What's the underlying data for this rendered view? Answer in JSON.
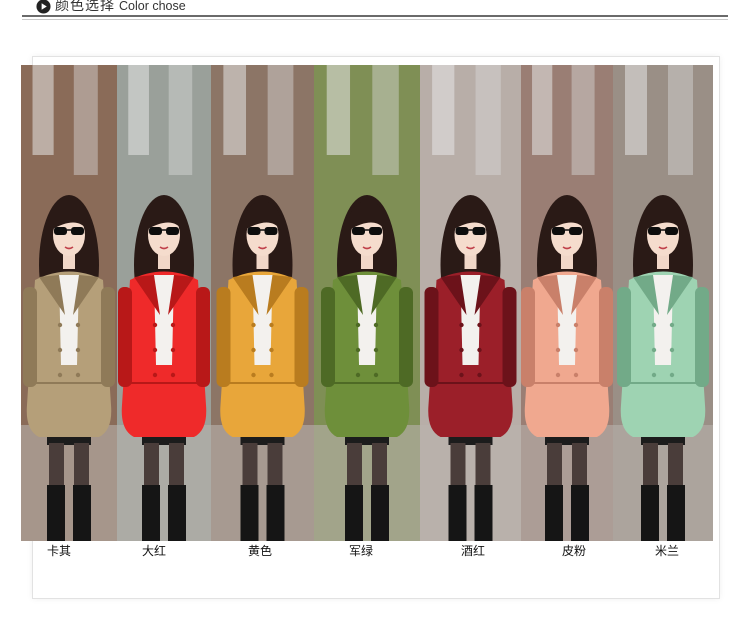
{
  "header": {
    "title_cn": "颜色选择",
    "title_en": "Color chose",
    "icon": "play-circle-icon"
  },
  "colors": [
    {
      "label": "卡其",
      "coat": "#b59f79",
      "coatDark": "#8f7a58",
      "bg": "#8a6b58"
    },
    {
      "label": "大红",
      "coat": "#ef2a2a",
      "coatDark": "#b81818",
      "bg": "#9aa09a"
    },
    {
      "label": "黄色",
      "coat": "#e8a63a",
      "coatDark": "#b97c1f",
      "bg": "#8c7566"
    },
    {
      "label": "军绿",
      "coat": "#6e8f3a",
      "coatDark": "#4e6a25",
      "bg": "#7f8f55"
    },
    {
      "label": "酒红",
      "coat": "#9b1f29",
      "coatDark": "#6c121a",
      "bg": "#b8aea8"
    },
    {
      "label": "皮粉",
      "coat": "#f0a88f",
      "coatDark": "#c9806a",
      "bg": "#9a7e74"
    },
    {
      "label": "米兰",
      "coat": "#9ed3b2",
      "coatDark": "#72aa88",
      "bg": "#9a8f86"
    }
  ]
}
